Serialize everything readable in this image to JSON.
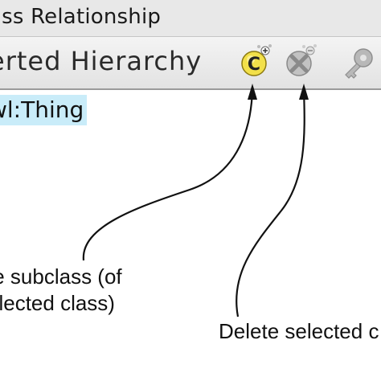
{
  "window": {
    "title": "ass Relationship"
  },
  "toolbar": {
    "hierarchy_title": "erted Hierarchy",
    "buttons": [
      {
        "id": "create",
        "icon": "create-subclass-icon"
      },
      {
        "id": "delete",
        "icon": "delete-class-icon"
      },
      {
        "id": "key",
        "icon": "key-icon"
      }
    ]
  },
  "tree": {
    "root_node": "wl:Thing"
  },
  "annotations": {
    "create_line1": "te subclass (of",
    "create_line2": "elected class)",
    "delete_line1": "Delete selected c"
  },
  "colors": {
    "selection": "#c9ecf9",
    "create_icon": "#f2e04a",
    "disabled_icon": "#a8a8a8"
  }
}
